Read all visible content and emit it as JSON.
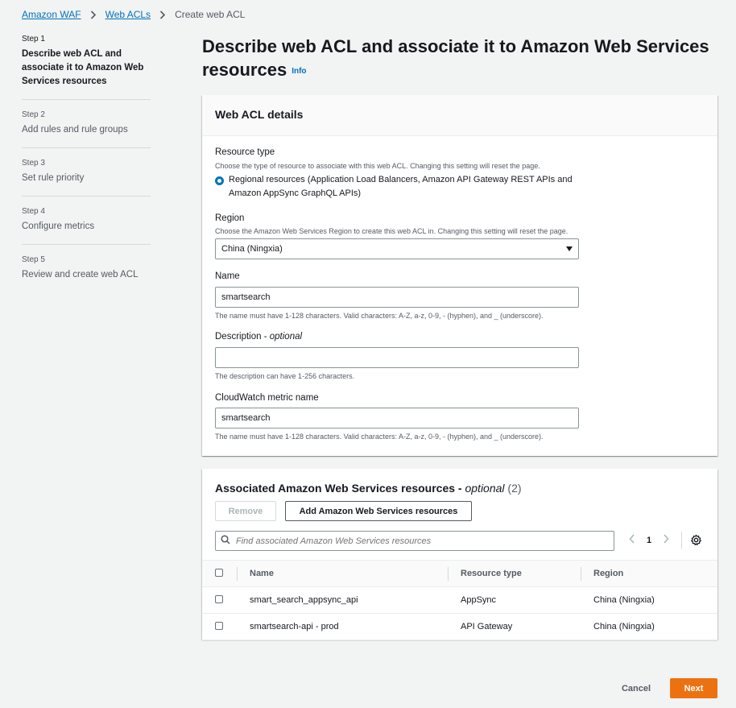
{
  "breadcrumb": {
    "items": [
      "Amazon WAF",
      "Web ACLs"
    ],
    "current": "Create web ACL"
  },
  "steps": [
    {
      "num": "Step 1",
      "label": "Describe web ACL and associate it to Amazon Web Services resources",
      "active": true
    },
    {
      "num": "Step 2",
      "label": "Add rules and rule groups"
    },
    {
      "num": "Step 3",
      "label": "Set rule priority"
    },
    {
      "num": "Step 4",
      "label": "Configure metrics"
    },
    {
      "num": "Step 5",
      "label": "Review and create web ACL"
    }
  ],
  "page": {
    "title": "Describe web ACL and associate it to Amazon Web Services resources",
    "info": "Info"
  },
  "details": {
    "heading": "Web ACL details",
    "resource_type": {
      "label": "Resource type",
      "desc": "Choose the type of resource to associate with this web ACL. Changing this setting will reset the page.",
      "option": "Regional resources (Application Load Balancers, Amazon API Gateway REST APIs and Amazon AppSync GraphQL APIs)"
    },
    "region": {
      "label": "Region",
      "desc": "Choose the Amazon Web Services Region to create this web ACL in. Changing this setting will reset the page.",
      "value": "China (Ningxia)"
    },
    "name": {
      "label": "Name",
      "value": "smartsearch",
      "hint": "The name must have 1-128 characters. Valid characters: A-Z, a-z, 0-9, - (hyphen), and _ (underscore)."
    },
    "description": {
      "label": "Description",
      "optional": "optional",
      "value": "",
      "hint": "The description can have 1-256 characters."
    },
    "metric": {
      "label": "CloudWatch metric name",
      "value": "smartsearch",
      "hint": "The name must have 1-128 characters. Valid characters: A-Z, a-z, 0-9, - (hyphen), and _ (underscore)."
    }
  },
  "resources": {
    "heading": "Associated Amazon Web Services resources",
    "optional": "optional",
    "count": "(2)",
    "remove_label": "Remove",
    "add_label": "Add Amazon Web Services resources",
    "search_placeholder": "Find associated Amazon Web Services resources",
    "page_number": "1",
    "columns": {
      "name": "Name",
      "type": "Resource type",
      "region": "Region"
    },
    "rows": [
      {
        "name": "smart_search_appsync_api",
        "type": "AppSync",
        "region": "China (Ningxia)"
      },
      {
        "name": "smartsearch-api - prod",
        "type": "API Gateway",
        "region": "China (Ningxia)"
      }
    ]
  },
  "footer": {
    "cancel_label": "Cancel",
    "next_label": "Next"
  },
  "colors": {
    "link": "#0073bb",
    "primary_button": "#ec7211",
    "background": "#f2f3f3"
  }
}
